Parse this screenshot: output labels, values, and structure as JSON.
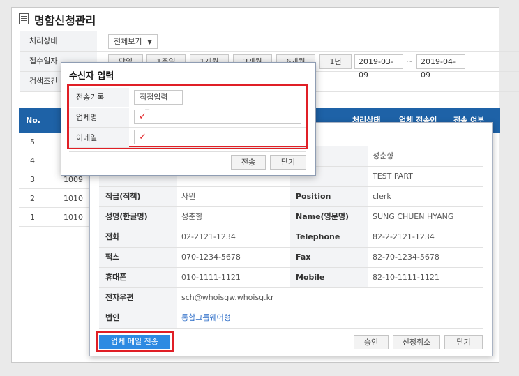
{
  "page": {
    "title": "명함신청관리"
  },
  "filters": {
    "status": {
      "label": "처리상태",
      "value": "전체보기"
    },
    "date": {
      "label": "접수일자",
      "ranges": [
        "당일",
        "1주일",
        "1개월",
        "3개월",
        "6개월",
        "1년"
      ],
      "from": "2019-03-09",
      "separator": "~",
      "to": "2019-04-09"
    },
    "search": {
      "label": "검색조건"
    }
  },
  "table": {
    "columns": [
      "No.",
      "처리상태",
      "업체 전송인",
      "전송 여부"
    ],
    "rows": [
      {
        "no": "5",
        "id": ""
      },
      {
        "no": "4",
        "id": ""
      },
      {
        "no": "3",
        "id": "1009"
      },
      {
        "no": "2",
        "id": "1010"
      },
      {
        "no": "1",
        "id": "1010"
      }
    ]
  },
  "detail": {
    "rows": [
      {
        "l1": "",
        "v1": "",
        "l2": "",
        "v2": "성춘향"
      },
      {
        "l1": "",
        "v1": "",
        "l2": "",
        "v2": "TEST PART"
      },
      {
        "l1": "직급(직책)",
        "v1": "사원",
        "l2": "Position",
        "v2": "clerk"
      },
      {
        "l1": "성명(한글명)",
        "v1": "성춘향",
        "l2": "Name(영문명)",
        "v2": "SUNG CHUEN HYANG"
      },
      {
        "l1": "전화",
        "v1": "02-2121-1234",
        "l2": "Telephone",
        "v2": "82-2-2121-1234"
      },
      {
        "l1": "팩스",
        "v1": "070-1234-5678",
        "l2": "Fax",
        "v2": "82-70-1234-5678"
      },
      {
        "l1": "휴대폰",
        "v1": "010-1111-1121",
        "l2": "Mobile",
        "v2": "82-10-1111-1121"
      }
    ],
    "email": {
      "label": "전자우편",
      "value": "sch@whoisgw.whoisg.kr"
    },
    "company": {
      "label": "법인",
      "value": "통합그룹웨어형"
    },
    "buttons": {
      "send_mail": "업체 메일 전송",
      "approve": "승인",
      "cancel_request": "신청취소",
      "close": "닫기"
    }
  },
  "popup": {
    "title": "수신자 입력",
    "history": {
      "label": "전송기록",
      "value": "직접입력"
    },
    "company": {
      "label": "업체명",
      "value": ""
    },
    "email": {
      "label": "이메일",
      "value": ""
    },
    "buttons": {
      "send": "전송",
      "close": "닫기"
    }
  },
  "colors": {
    "header_blue": "#1e62a7",
    "highlight_red": "#e01f26",
    "primary_button": "#2d8ae2",
    "link_blue": "#2a6bc7"
  },
  "icons": {
    "title": "list-icon",
    "dropdown": "caret-down-icon",
    "required": "checkmark-icon"
  }
}
